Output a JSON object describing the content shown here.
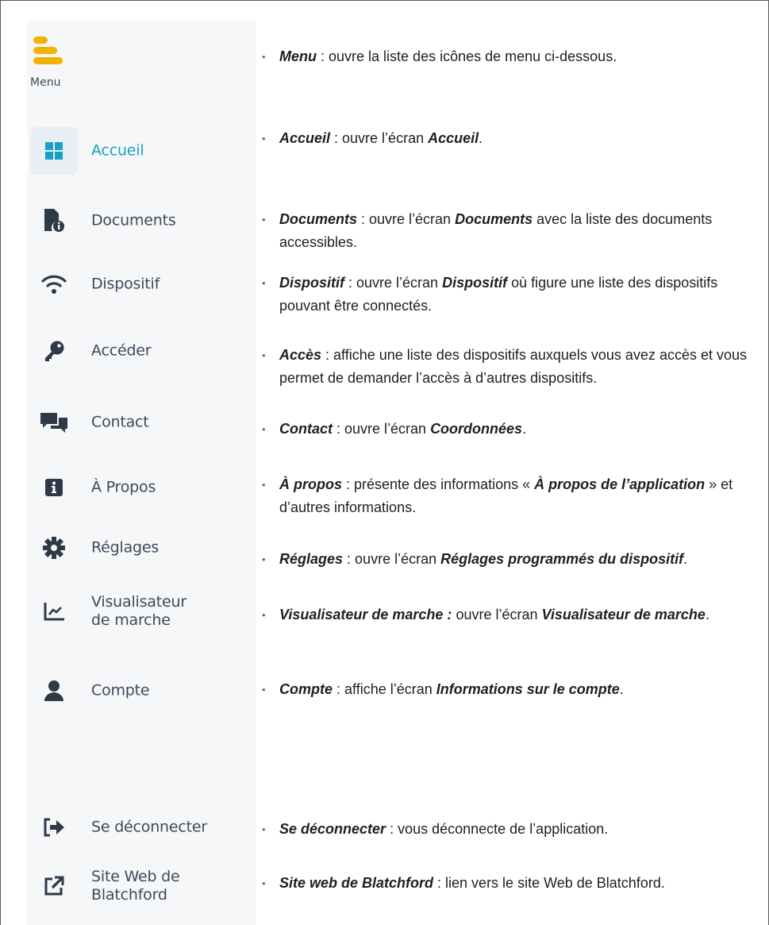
{
  "menu": {
    "label": "Menu",
    "items": [
      {
        "id": "accueil",
        "label": "Accueil",
        "icon": "grid-icon",
        "active": true
      },
      {
        "id": "documents",
        "label": "Documents",
        "icon": "document-info-icon"
      },
      {
        "id": "dispositif",
        "label": "Dispositif",
        "icon": "wifi-icon"
      },
      {
        "id": "acceder",
        "label": "Accéder",
        "icon": "key-icon"
      },
      {
        "id": "contact",
        "label": "Contact",
        "icon": "chat-icon"
      },
      {
        "id": "apropos",
        "label": "À Propos",
        "icon": "info-icon"
      },
      {
        "id": "reglages",
        "label": "Réglages",
        "icon": "gear-icon"
      },
      {
        "id": "visualisateur",
        "label_line1": "Visualisateur",
        "label_line2": "de marche",
        "icon": "chart-icon"
      },
      {
        "id": "compte",
        "label": "Compte",
        "icon": "user-icon"
      },
      {
        "id": "deconnecter",
        "label": "Se déconnecter",
        "icon": "logout-icon"
      },
      {
        "id": "siteweb",
        "label_line1": "Site Web de",
        "label_line2": "Blatchford",
        "icon": "external-link-icon"
      }
    ]
  },
  "colors": {
    "menu_icon": "#f2b300",
    "active": "#1aa0c6",
    "icon": "#2e3a48"
  },
  "descriptions": [
    {
      "id": "menu",
      "t1": "Menu",
      "t2": " : ouvre la liste des icônes de menu ci-dessous."
    },
    {
      "id": "accueil",
      "t1": "Accueil",
      "t2": " : ouvre l’écran ",
      "t3": "Accueil",
      "t4": "."
    },
    {
      "id": "documents",
      "t1": "Documents",
      "t2": " : ouvre l’écran ",
      "t3": "Documents",
      "t4": " avec la liste des documents accessibles."
    },
    {
      "id": "dispositif",
      "t1": "Dispositif",
      "t2": " : ouvre l’écran ",
      "t3": "Dispositif",
      "t4": " où figure une liste des dispositifs pouvant être connectés."
    },
    {
      "id": "acces",
      "t1": "Accès",
      "t2": " : affiche une liste des dispositifs auxquels vous avez accès et vous permet de demander l’accès à d’autres dispositifs."
    },
    {
      "id": "contact",
      "t1": "Contact",
      "t2": " : ouvre l’écran ",
      "t3": "Coordonnées",
      "t4": "."
    },
    {
      "id": "apropos",
      "t1": "À propos",
      "t2": " : présente des informations « ",
      "t3": "À propos de l’application",
      "t4": " » et d’autres informations."
    },
    {
      "id": "reglages",
      "t1": "Réglages",
      "t2": " : ouvre l’écran ",
      "t3": "Réglages programmés du dispositif",
      "t4": "."
    },
    {
      "id": "visualisateur",
      "t1": "Visualisateur de marche :",
      "t2": " ouvre l’écran ",
      "t3": "Visualisateur de marche",
      "t4": "."
    },
    {
      "id": "compte",
      "t1": "Compte",
      "t2": " : affiche l’écran ",
      "t3": "Informations sur le compte",
      "t4": "."
    },
    {
      "id": "deconnecter",
      "t1": "Se déconnecter",
      "t2": " : vous déconnecte de l’application."
    },
    {
      "id": "siteweb",
      "t1": "Site web de Blatchford",
      "t2": " : lien vers le site Web de Blatchford."
    }
  ]
}
